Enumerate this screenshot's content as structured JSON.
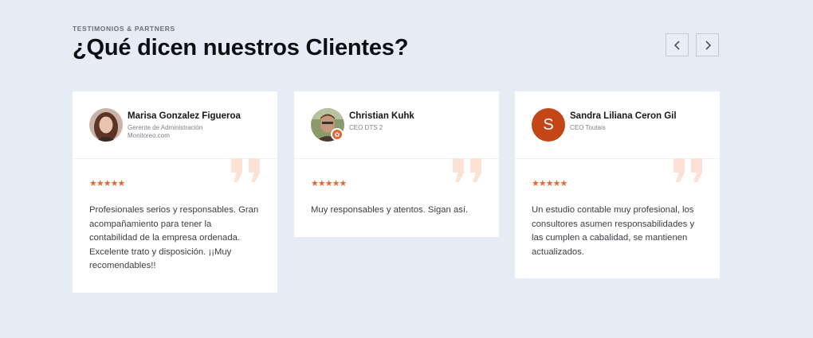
{
  "section": {
    "eyebrow": "TESTIMONIOS & PARTNERS",
    "title": "¿Qué dicen nuestros Clientes?"
  },
  "nav": {
    "prev_icon": "chevron-left-icon",
    "next_icon": "chevron-right-icon"
  },
  "colors": {
    "accent": "#e06a34",
    "quote_mark": "#fbe2d4",
    "background": "#e6ecf5"
  },
  "testimonials": [
    {
      "name": "Marisa Gonzalez Figueroa",
      "role_line1": "Gerente de Administración",
      "role_line2": "Monitoreo.com",
      "rating": 5,
      "stars": "★★★★★",
      "text": "Profesionales serios y responsables. Gran acompañamiento para tener la contabilidad de la empresa ordenada. Excelente trato y disposición. ¡¡Muy recomendables!!"
    },
    {
      "name": "Christian Kuhk",
      "role_line1": "CEO DTS 2",
      "rating": 5,
      "stars": "★★★★★",
      "text": "Muy responsables y atentos. Sigan así."
    },
    {
      "name": "Sandra Liliana Ceron Gil",
      "role_line1": "CEO Toutais",
      "avatar_letter": "S",
      "rating": 5,
      "stars": "★★★★★",
      "text": "Un estudio contable muy profesional, los consultores asumen responsabilidades y las cumplen a cabalidad, se mantienen actualizados."
    }
  ]
}
